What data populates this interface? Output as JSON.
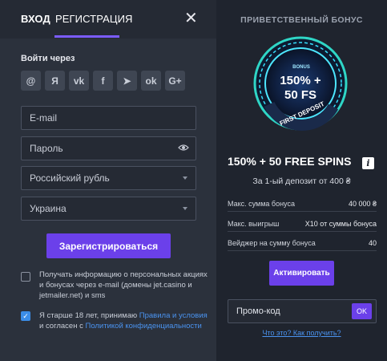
{
  "tabs": {
    "login": "ВХОД",
    "register": "РЕГИСТРАЦИЯ",
    "close": "✕"
  },
  "social": {
    "title": "Войти через",
    "icons": [
      {
        "name": "email-icon",
        "glyph": "@"
      },
      {
        "name": "yandex-icon",
        "glyph": "Я"
      },
      {
        "name": "vk-icon",
        "glyph": "vk"
      },
      {
        "name": "facebook-icon",
        "glyph": "f"
      },
      {
        "name": "telegram-icon",
        "glyph": "➤"
      },
      {
        "name": "odnoklassniki-icon",
        "glyph": "ok"
      },
      {
        "name": "google-plus-icon",
        "glyph": "G+"
      }
    ]
  },
  "form": {
    "email_placeholder": "E-mail",
    "password_placeholder": "Пароль",
    "currency_selected": "Российский рубль",
    "country_selected": "Украина",
    "submit": "Зарегистрироваться"
  },
  "consents": {
    "newsletter": "Получать информацию о персональных акциях и бонусах через e-mail (домены jet.casino и jetmailer.net) и sms",
    "age_prefix": "Я старше 18 лет, принимаю",
    "rules_link": "Правила и условия",
    "age_middle": "и согласен с",
    "privacy_link": "Политикой конфиденциальности"
  },
  "bonus": {
    "heading": "ПРИВЕТСТВЕННЫЙ БОНУС",
    "badge_top": "BONUS",
    "badge_line1": "150% +",
    "badge_line2": "50 FS",
    "badge_ring": "FIRST DEPOSIT",
    "offer": "150% + 50 FREE SPINS",
    "info": "i",
    "offer_sub": "За 1-ый депозит от 400 ₴",
    "rows": [
      {
        "label": "Макс. сумма бонуса",
        "value": "40 000 ₴"
      },
      {
        "label": "Макс. выигрыш",
        "value": "X10 от суммы бонуса"
      },
      {
        "label": "Вейджер на сумму бонуса",
        "value": "40"
      }
    ],
    "activate": "Активировать",
    "promo_label": "Промо-код",
    "promo_ok": "OK",
    "help_link": "Что это? Как получить?"
  }
}
